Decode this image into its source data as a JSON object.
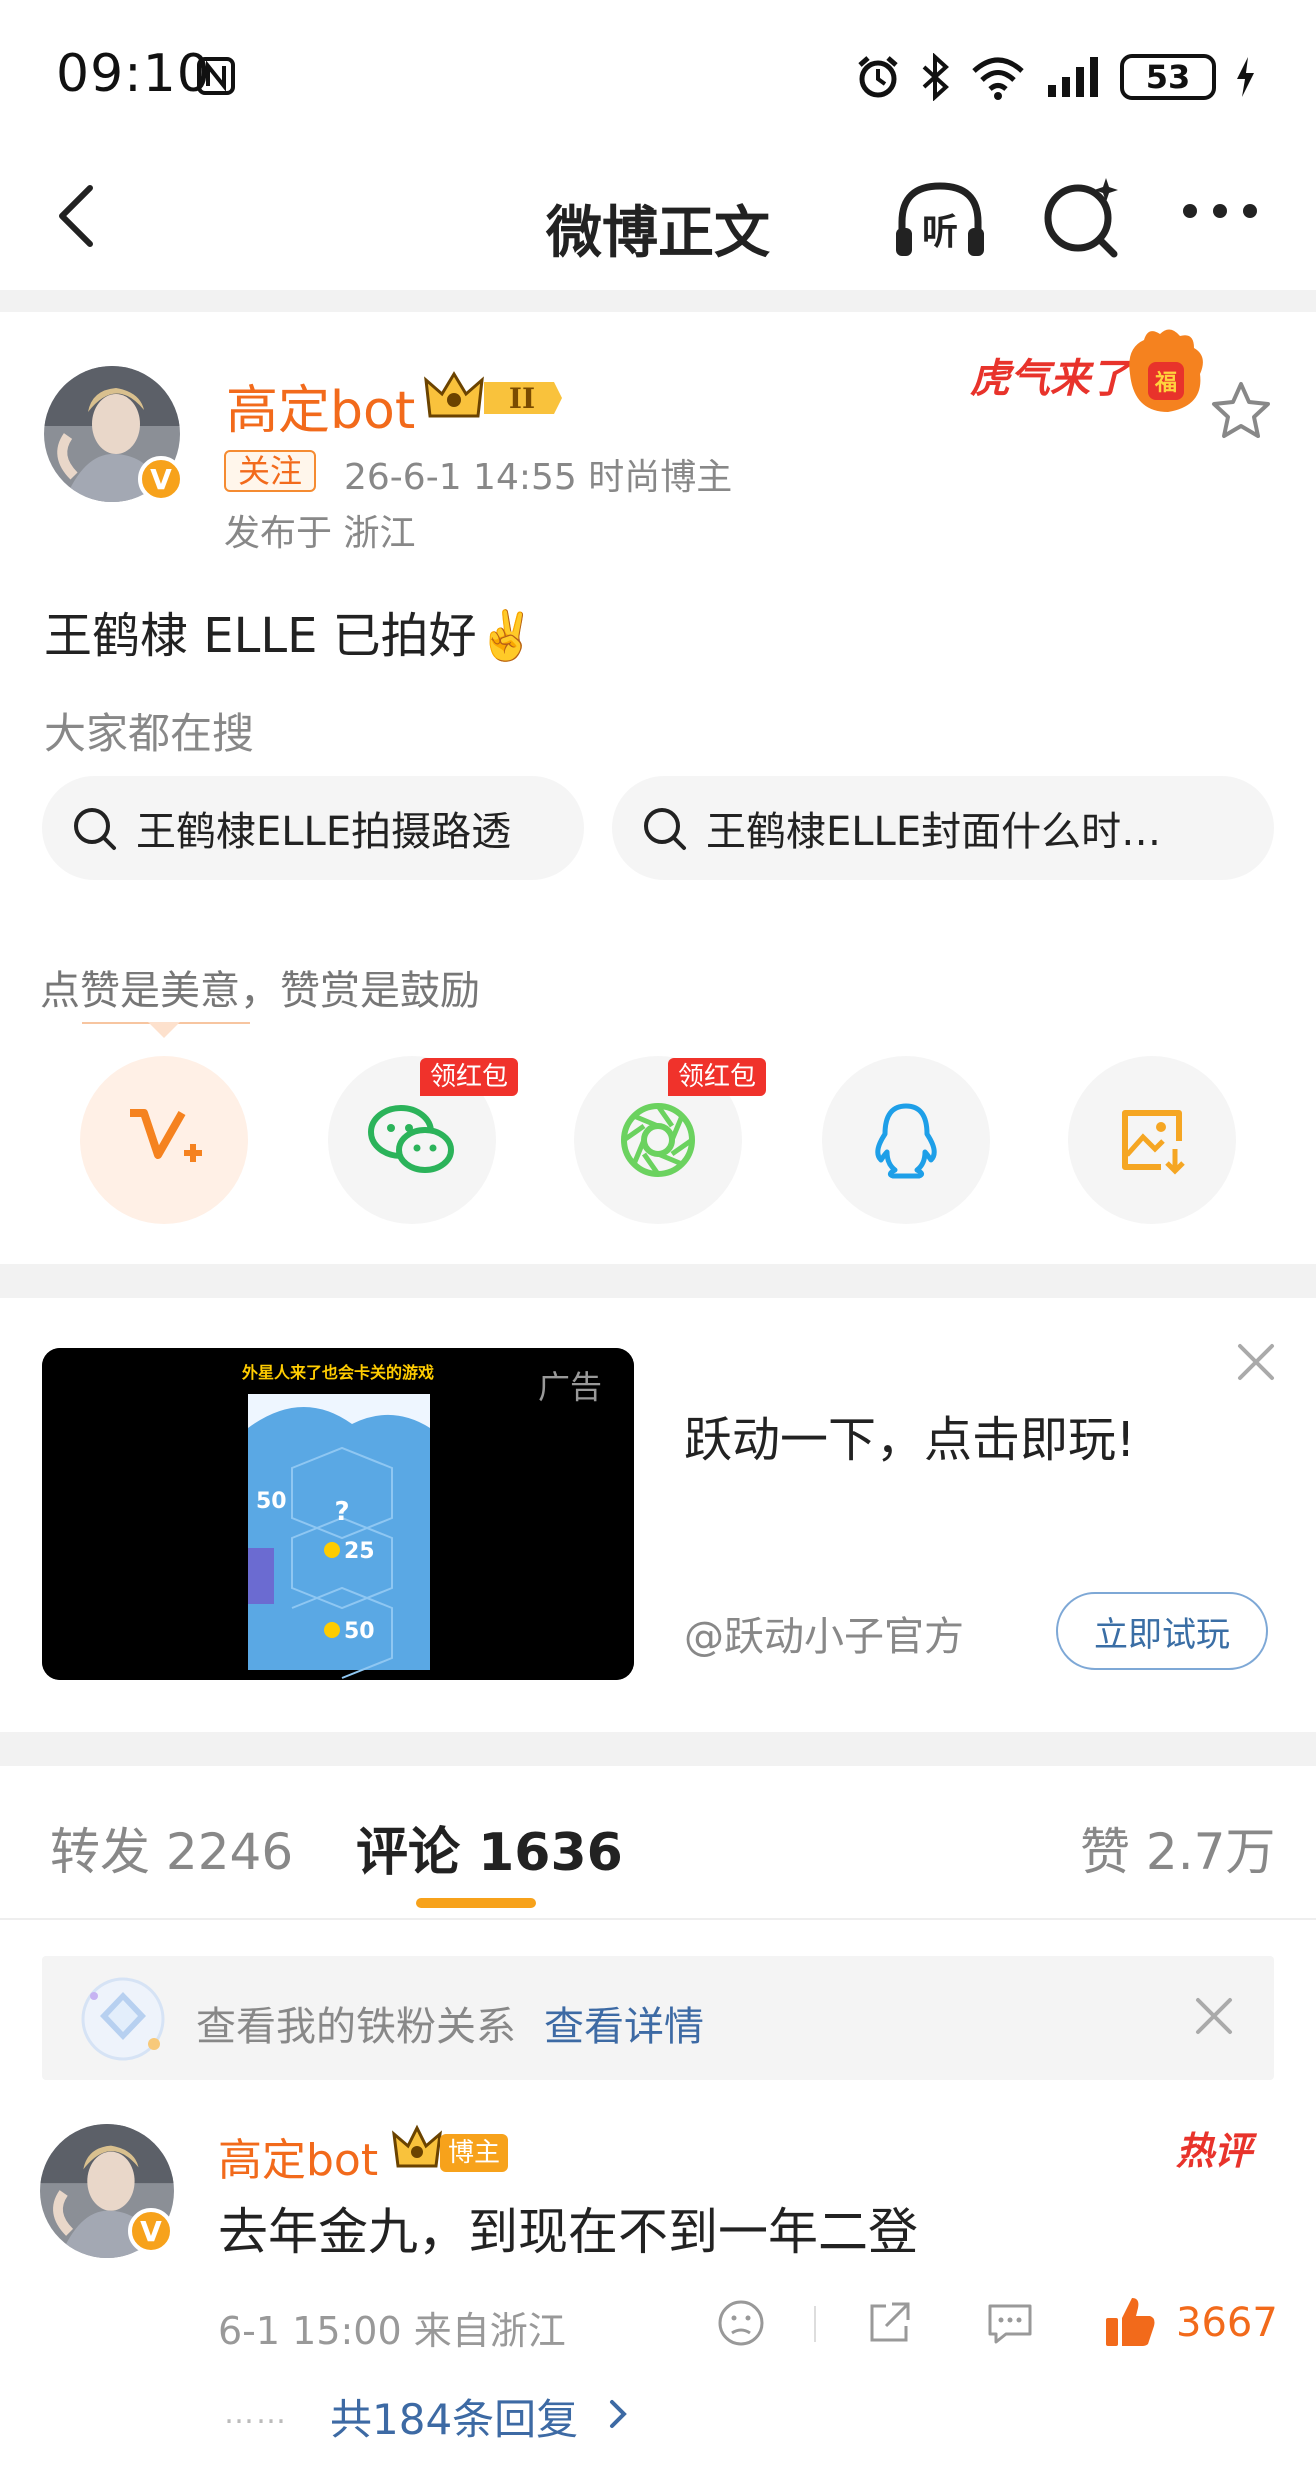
{
  "status_bar": {
    "time": "09:10",
    "battery": "53"
  },
  "nav": {
    "title": "微博正文",
    "listen_label": "听"
  },
  "post": {
    "author": "高定bot",
    "level_badge": "II",
    "follow_label": "关注",
    "meta": "26-6-1 14:55  时尚博主",
    "location": "发布于 浙江",
    "sticker_text": "虎气来了",
    "text": "王鹤棣 ELLE 已拍好✌️"
  },
  "search": {
    "heading": "大家都在搜",
    "chips": [
      "王鹤棣ELLE拍摄路透",
      "王鹤棣ELLE封面什么时…"
    ]
  },
  "reward": {
    "text": "点赞是美意，赞赏是鼓励",
    "redpack_label": "领红包"
  },
  "ad": {
    "label": "广告",
    "title": "跃动一下，点击即玩!",
    "source": "@跃动小子官方",
    "cta": "立即试玩",
    "video_caption": "外星人来了也会卡关的游戏",
    "video_numbers": [
      "50",
      "25",
      "50"
    ]
  },
  "tabs": {
    "repost": "转发 2246",
    "comment": "评论 1636",
    "like": "赞 2.7万"
  },
  "fan_banner": {
    "text": "查看我的铁粉关系",
    "link": "查看详情"
  },
  "comment": {
    "author": "高定bot",
    "badge": "博主",
    "hot": "热评",
    "text": "去年金九，到现在不到一年二登",
    "meta": "6-1 15:00  来自浙江",
    "likes": "3667",
    "replies": "共184条回复",
    "reply_dots": "……"
  },
  "colors": {
    "accent": "#f26a1b",
    "link": "#3d6aa4",
    "gold": "#f7a21b",
    "red": "#f0322b"
  },
  "icons": [
    "back-icon",
    "headphone-icon",
    "ai-search-icon",
    "more-icon",
    "star-icon",
    "search-icon",
    "v-plus-icon",
    "wechat-icon",
    "moments-icon",
    "qq-icon",
    "save-image-icon",
    "close-icon",
    "diamond-icon",
    "face-icon",
    "share-icon",
    "reply-icon",
    "thumb-up-icon",
    "chevron-right-icon"
  ]
}
